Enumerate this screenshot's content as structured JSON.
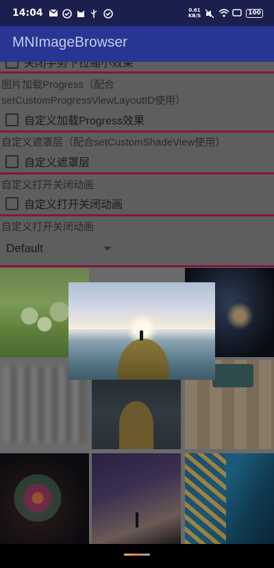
{
  "status_bar": {
    "time": "14:04",
    "left_icons": [
      "mail-icon",
      "check-circle-icon",
      "cat-icon",
      "usb-icon",
      "check-circle-icon"
    ],
    "speed_top": "0.61",
    "speed_bottom": "KB/S",
    "battery": "100"
  },
  "app_bar": {
    "title": "MNImageBrowser",
    "background": "#283593"
  },
  "settings": {
    "partial_top_label": "关闭手势下拉缩小效果",
    "progress_section": {
      "line1": "图片加载Progress（配合",
      "line2": "setCustomProgressViewLayoutID使用）",
      "checkbox_label": "自定义加载Progress效果"
    },
    "shade_section": {
      "title": "自定义遮罩层（配合setCustomShadeView使用）",
      "checkbox_label": "自定义遮罩层"
    },
    "anim_section": {
      "title": "自定义打开关闭动画",
      "checkbox_label": "自定义打开关闭动画"
    },
    "anim_select_section": {
      "title": "自定义打开关闭动画",
      "selected": "Default"
    },
    "divider_color": "#8a1340"
  }
}
